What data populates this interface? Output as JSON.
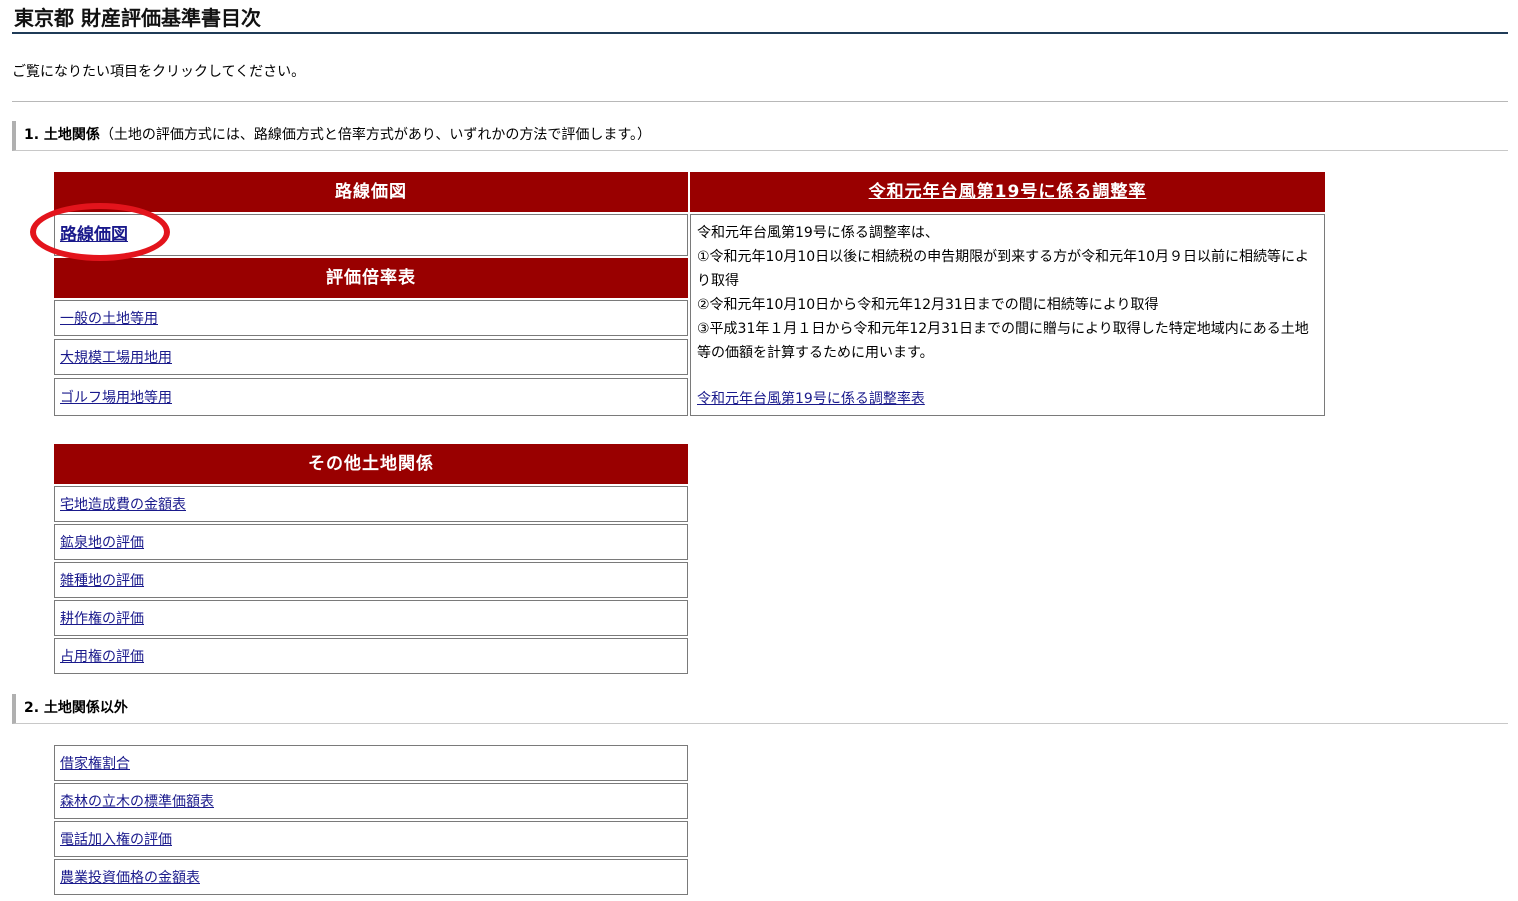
{
  "header": {
    "title": "東京都 財産評価基準書目次",
    "intro": "ご覧になりたい項目をクリックしてください。"
  },
  "section1": {
    "label": "1. 土地関係",
    "note": "（土地の評価方式には、路線価方式と倍率方式があり、いずれかの方法で評価します。）",
    "rosen_header": "路線価図",
    "rosen_link": "路線価図",
    "bairitsu_header": "評価倍率表",
    "bairitsu_links": [
      "一般の土地等用",
      "大規模工場用地用",
      "ゴルフ場用地等用"
    ],
    "typhoon_header": "令和元年台風第19号に係る調整率",
    "typhoon_desc": [
      "令和元年台風第19号に係る調整率は、",
      "①令和元年10月10日以後に相続税の申告期限が到来する方が令和元年10月９日以前に相続等により取得",
      "②令和元年10月10日から令和元年12月31日までの間に相続等により取得",
      "③平成31年１月１日から令和元年12月31日までの間に贈与により取得した特定地域内にある土地等の価額を計算するために用います。"
    ],
    "typhoon_link": "令和元年台風第19号に係る調整率表",
    "other_header": "その他土地関係",
    "other_links": [
      "宅地造成費の金額表",
      "鉱泉地の評価",
      "雑種地の評価",
      "耕作権の評価",
      "占用権の評価"
    ]
  },
  "section2": {
    "label": "2. 土地関係以外",
    "links": [
      "借家権割合",
      "森林の立木の標準価額表",
      "電話加入権の評価",
      "農業投資価格の金額表"
    ]
  },
  "colors": {
    "header_bg": "#990000",
    "link": "#1a1a8c",
    "highlight": "#e3141c"
  }
}
